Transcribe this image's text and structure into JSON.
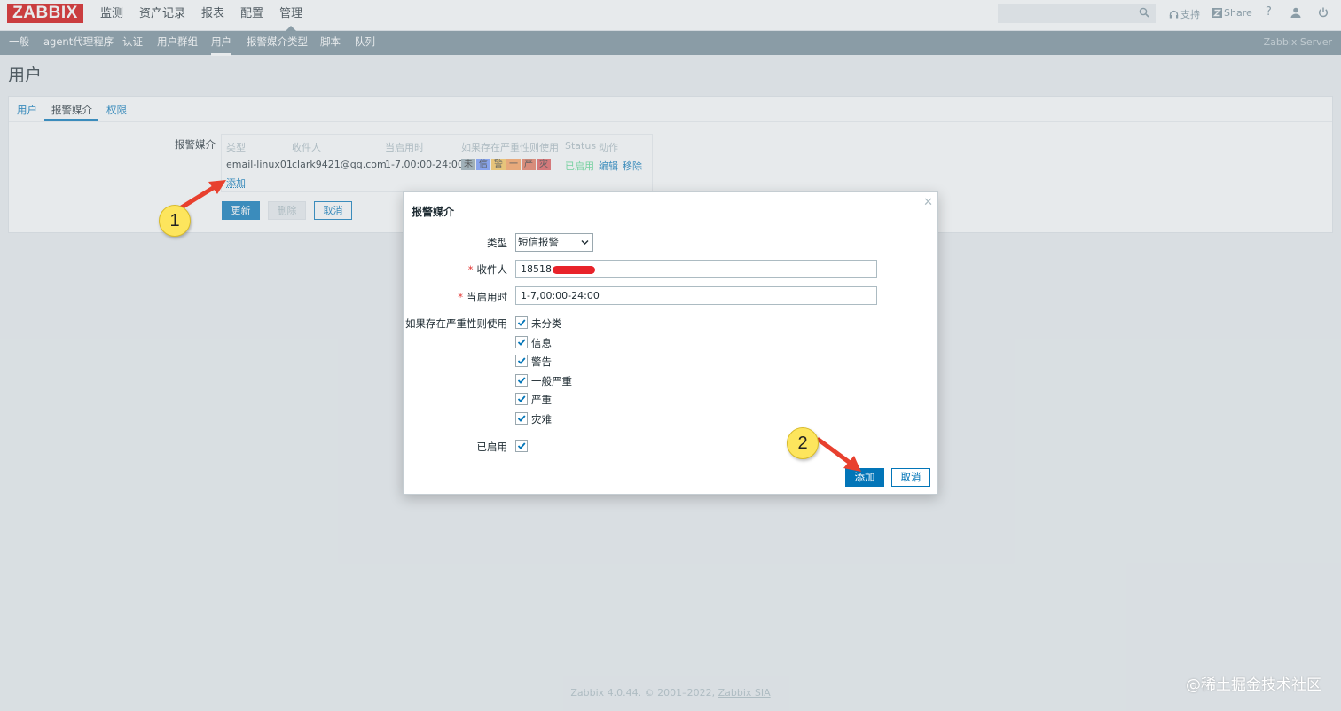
{
  "app": {
    "logo": "ZABBIX",
    "server_name": "Zabbix Server"
  },
  "top_menu": [
    {
      "label": "监测"
    },
    {
      "label": "资产记录"
    },
    {
      "label": "报表"
    },
    {
      "label": "配置"
    },
    {
      "label": "管理"
    }
  ],
  "top_right": {
    "search_value": "",
    "support": "支持",
    "share": "Share",
    "help": "?"
  },
  "sub_menu": [
    {
      "label": "一般"
    },
    {
      "label": "agent代理程序"
    },
    {
      "label": "认证"
    },
    {
      "label": "用户群组"
    },
    {
      "label": "用户"
    },
    {
      "label": "报警媒介类型"
    },
    {
      "label": "脚本"
    },
    {
      "label": "队列"
    }
  ],
  "page_title": "用户",
  "tabs": [
    {
      "label": "用户"
    },
    {
      "label": "报警媒介"
    },
    {
      "label": "权限"
    }
  ],
  "media_section": {
    "label": "报警媒介",
    "headers": [
      "类型",
      "收件人",
      "当启用时",
      "如果存在严重性则使用",
      "Status",
      "动作"
    ],
    "row": {
      "type": "email-linux01",
      "recipient": "clark9421@qq.com",
      "when_active": "1-7,00:00-24:00",
      "severities": [
        {
          "short": "未",
          "color": "#97aab3"
        },
        {
          "short": "信",
          "color": "#7499ff"
        },
        {
          "short": "警",
          "color": "#ffc859"
        },
        {
          "short": "一",
          "color": "#ffa059"
        },
        {
          "short": "严",
          "color": "#e97659"
        },
        {
          "short": "灾",
          "color": "#e45959"
        }
      ],
      "status": "已启用",
      "edit": "编辑",
      "remove": "移除"
    },
    "add_link": "添加"
  },
  "buttons": {
    "update": "更新",
    "delete": "删除",
    "cancel": "取消"
  },
  "modal": {
    "title": "报警媒介",
    "type_label": "类型",
    "type_value": "短信报警",
    "recipient_label": "收件人",
    "recipient_value": "18518",
    "when_active_label": "当启用时",
    "when_active_value": "1-7,00:00-24:00",
    "severity_label": "如果存在严重性则使用",
    "severities": [
      {
        "label": "未分类",
        "checked": true
      },
      {
        "label": "信息",
        "checked": true
      },
      {
        "label": "警告",
        "checked": true
      },
      {
        "label": "一般严重",
        "checked": true
      },
      {
        "label": "严重",
        "checked": true
      },
      {
        "label": "灾难",
        "checked": true
      }
    ],
    "enabled_label": "已启用",
    "enabled_checked": true,
    "add_button": "添加",
    "cancel_button": "取消"
  },
  "annotations": [
    {
      "number": "1"
    },
    {
      "number": "2"
    }
  ],
  "footer": {
    "text": "Zabbix 4.0.44. © 2001–2022, ",
    "link": "Zabbix SIA"
  },
  "watermark": "@稀土掘金技术社区"
}
